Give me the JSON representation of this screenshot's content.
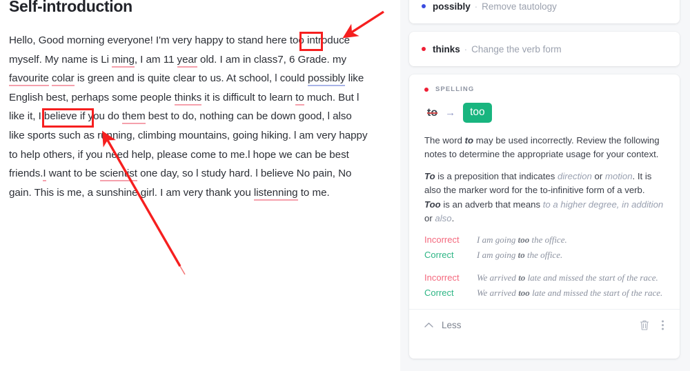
{
  "document": {
    "title": "Self-introduction",
    "paragraph_plain": "Hello, Good morning everyone!  I'm very happy to stand here too introduce myself. My name is Li ming, I am 11 year old. I am in class7, 6 Grade. my favourite colar is green and is quite clear to us. At school, l could possibly like English best, perhaps some people thinks it is difficult to learn to much. But l like it, I believe if you do them best to do, nothing can be down good, l also like sports such as running, climbing mountains, going hiking. l am very happy to help others, if you need help, please come to me.l  hope we can be best friends.I want to be scientist one day, so l study hard. l believe  No pain, No gain. This is me, a sunshine girl. I am very thank you listenning  to me.",
    "segments": [
      {
        "t": "Hello, Good morning everyone!  I'm very happy to stand here ",
        "u": ""
      },
      {
        "t": "too",
        "u": "box"
      },
      {
        "t": " introduce myself. My name is Li ",
        "u": ""
      },
      {
        "t": "ming",
        "u": "red"
      },
      {
        "t": ", I am 11 ",
        "u": ""
      },
      {
        "t": "year",
        "u": "red"
      },
      {
        "t": " old. I am in class7, 6 Grade. my ",
        "u": ""
      },
      {
        "t": "favourite",
        "u": "red"
      },
      {
        "t": " ",
        "u": ""
      },
      {
        "t": "colar",
        "u": "red"
      },
      {
        "t": " is green and is quite clear to us. At school, l could ",
        "u": ""
      },
      {
        "t": "possibly",
        "u": "blue"
      },
      {
        "t": " like English best, perhaps some people ",
        "u": ""
      },
      {
        "t": "thinks",
        "u": "red"
      },
      {
        "t": " it is difficult to learn ",
        "u": ""
      },
      {
        "t": "to",
        "u": "red"
      },
      {
        "t": " much. But l like it, I believe if you do ",
        "u": ""
      },
      {
        "t": "them",
        "u": "red"
      },
      {
        "t": " best to do, nothing can be down good, l also like sports such as running, climbing mountains, going hiking. l am very happy to help others, if you need help, please come to me.l  hope we can be best friends.",
        "u": ""
      },
      {
        "t": "I",
        "u": "red"
      },
      {
        "t": " want to be ",
        "u": ""
      },
      {
        "t": "scientist",
        "u": "red"
      },
      {
        "t": " one day, so l study hard. l believe  No pain, No gain. This is me, a sunshine girl. I am very thank you ",
        "u": ""
      },
      {
        "t": "listenning",
        "u": "red"
      },
      {
        "t": "  to me.",
        "u": ""
      }
    ]
  },
  "annotations": {
    "box_color": "#f61f1f",
    "arrow_color": "#f61f1f",
    "boxes": [
      {
        "name": "highlight-box-too",
        "label": "too"
      },
      {
        "name": "highlight-box-to-much",
        "label": "to much."
      }
    ],
    "arrows": [
      {
        "name": "arrow-to-too"
      },
      {
        "name": "arrow-to-to-much"
      }
    ]
  },
  "sidebar": {
    "cards": [
      {
        "type": "mini",
        "dot_color": "#3b4ce0",
        "word": "possibly",
        "separator": "·",
        "description": "Remove tautology"
      },
      {
        "type": "mini",
        "dot_color": "#ef1f35",
        "word": "thinks",
        "separator": "·",
        "description": "Change the verb form"
      }
    ],
    "spelling_card": {
      "dot_color": "#ef1f35",
      "category": "SPELLING",
      "suggestion": {
        "from": "to",
        "arrow": "→",
        "to": "too",
        "accent_color": "#19b57f"
      },
      "explanation": {
        "lead_1": "The word ",
        "lead_word": "to",
        "lead_2": " may be used incorrectly. Review the following notes to determine the appropriate usage for your context."
      },
      "notes": [
        {
          "word": "To",
          "text_1": " is a preposition that indicates ",
          "em_1": "direction",
          "text_2": " or ",
          "em_2": "motion",
          "text_3": ". It is also the marker word for the to-infinitive form of a verb."
        },
        {
          "word": "Too",
          "text_1": " is an adverb that means ",
          "em_1": "to a higher degree, in addition",
          "text_2": " or ",
          "em_2": "also",
          "text_3": "."
        }
      ],
      "examples": [
        {
          "tag": "Incorrect",
          "tag_color": "#f4687d",
          "pre": "I am going ",
          "bold": "too",
          "post": " the office."
        },
        {
          "tag": "Correct",
          "tag_color": "#2cb584",
          "pre": "I am going ",
          "bold": "to",
          "post": " the office."
        },
        {
          "tag": "Incorrect",
          "tag_color": "#f4687d",
          "pre": "We arrived ",
          "bold": "to",
          "post": " late and missed the start of the race."
        },
        {
          "tag": "Correct",
          "tag_color": "#2cb584",
          "pre": "We arrived ",
          "bold": "too",
          "post": " late and missed the start of the race."
        }
      ],
      "footer": {
        "collapse_label": "Less",
        "chevron_icon": "chevron-up-icon",
        "delete_icon": "trash-icon",
        "more_icon": "more-vertical-icon"
      }
    }
  }
}
